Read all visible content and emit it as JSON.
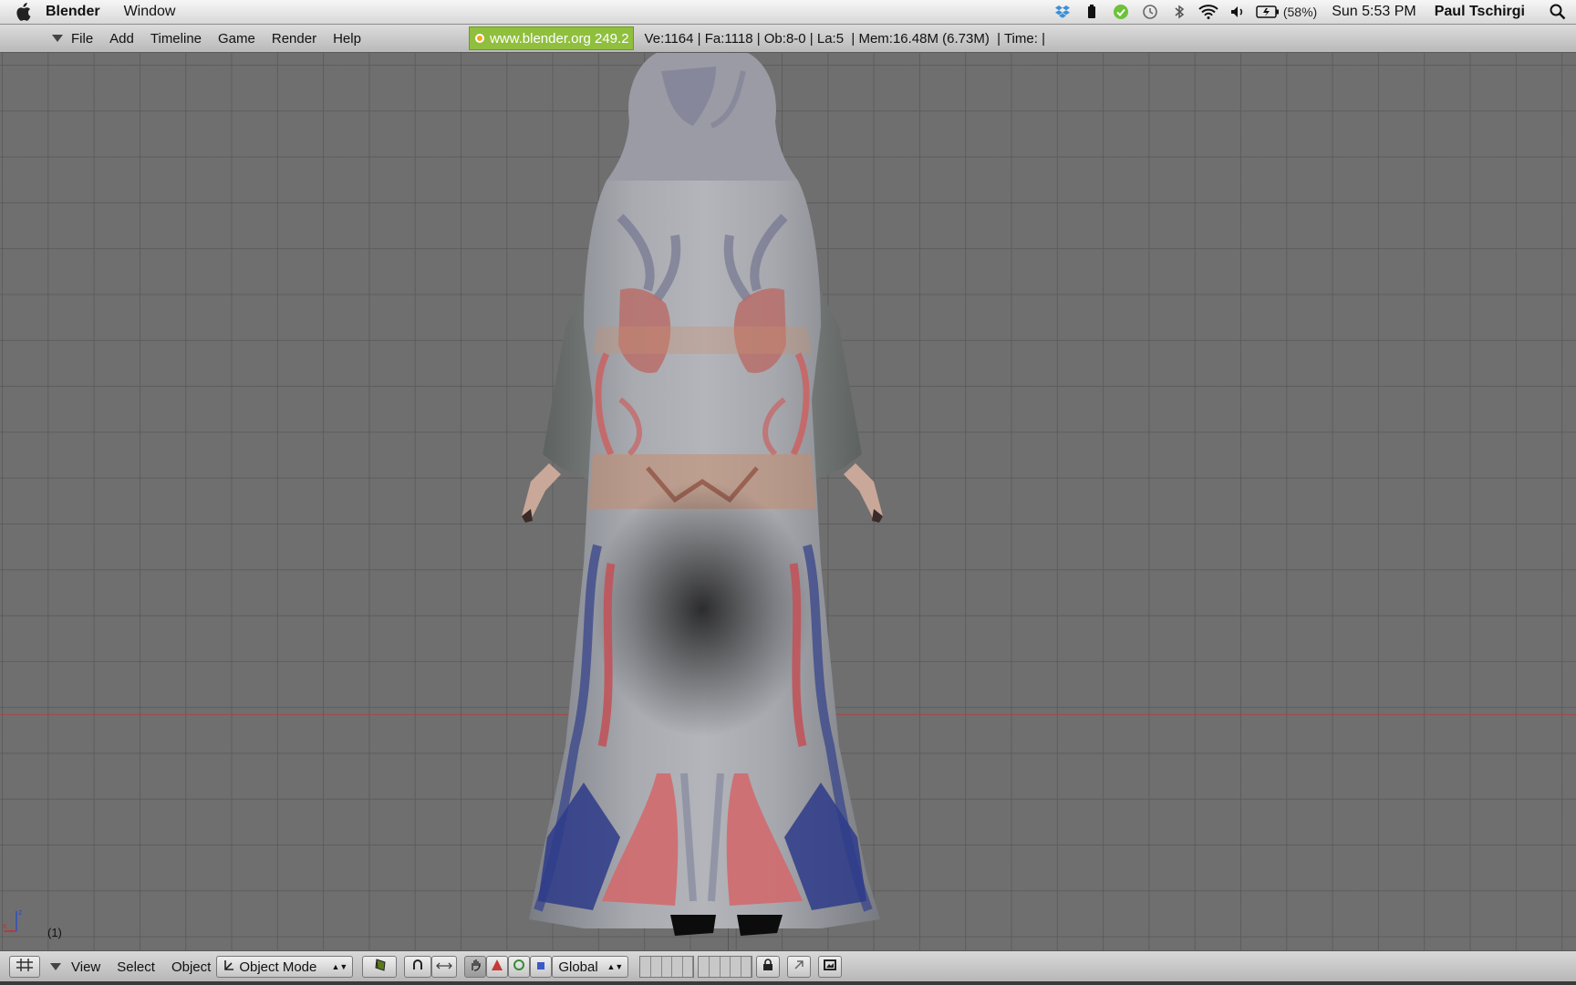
{
  "menubar": {
    "app_name": "Blender",
    "items": [
      "Window"
    ],
    "battery_percent": "(58%)",
    "clock": "Sun 5:53 PM",
    "user": "Paul Tschirgi",
    "tray_icons": [
      "dropbox-icon",
      "battery-app-icon",
      "checkmark-app-icon",
      "time-machine-icon",
      "bluetooth-icon",
      "wifi-icon",
      "volume-icon",
      "battery-icon"
    ]
  },
  "info_header": {
    "menus": [
      "File",
      "Add",
      "Timeline",
      "Game",
      "Render",
      "Help"
    ],
    "badge": "www.blender.org 249.2",
    "stats": "Ve:1164 | Fa:1118 | Ob:8-0 | La:5  | Mem:16.48M (6.73M)  | Time: |"
  },
  "viewport": {
    "frame_label": "(1)",
    "axis_labels": {
      "x": "x",
      "z": "z"
    },
    "colors": {
      "background": "#6f6f6f",
      "grid": "#5a5a5a",
      "x_axis": "#9c4d4d"
    }
  },
  "view_header": {
    "menus": [
      "View",
      "Select",
      "Object"
    ],
    "mode": "Object Mode",
    "orientation": "Global",
    "icons": [
      "grid-icon",
      "shading-icon",
      "pivot-icon",
      "snap-icon",
      "manipulator-hand-icon",
      "translate-icon",
      "rotate-icon",
      "scale-icon",
      "lock-icon",
      "link-icon",
      "render-icon"
    ]
  }
}
